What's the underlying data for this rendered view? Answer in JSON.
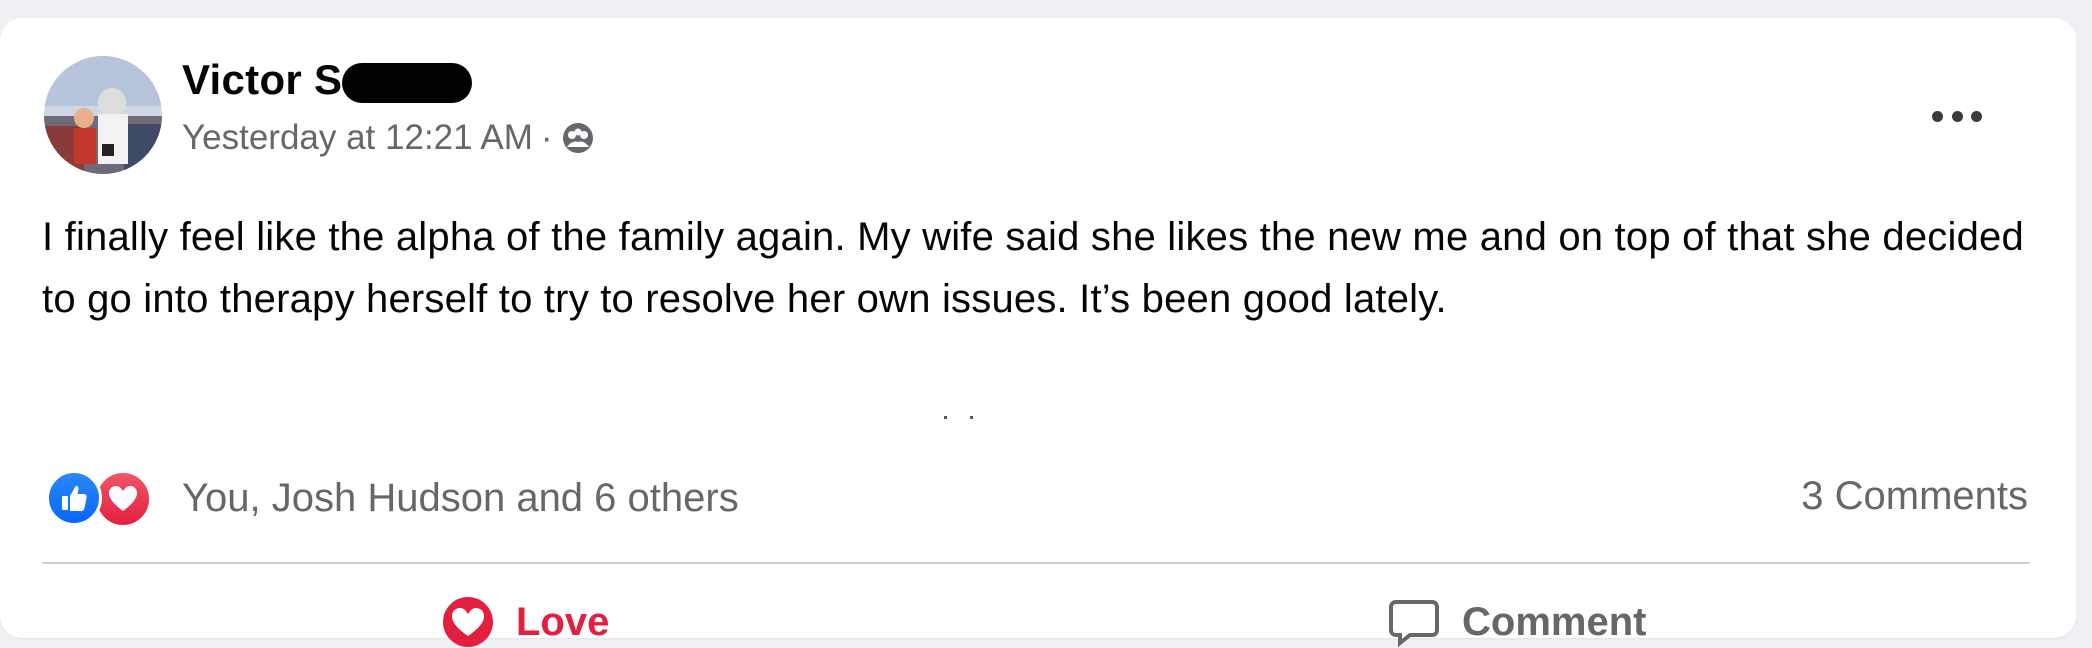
{
  "post": {
    "author": "Victor S",
    "timestamp": "Yesterday at 12:21 AM",
    "separator": "·",
    "audience_icon": "friends-icon",
    "text": "I finally feel like the alpha of the family again. My wife said she likes the new me and on top of that she decided to go into therapy herself to try to resolve her own issues. It’s been good lately."
  },
  "reactions": {
    "icons": [
      "like-icon",
      "love-icon"
    ],
    "summary": "You, Josh Hudson and 6 others"
  },
  "comments": {
    "count_label": "3 Comments"
  },
  "actions": {
    "love_label": "Love",
    "comment_label": "Comment"
  },
  "colors": {
    "accent_love": "#e41e3f",
    "accent_like": "#0866ff",
    "secondary_text": "#65676b",
    "primary_text": "#050505"
  }
}
